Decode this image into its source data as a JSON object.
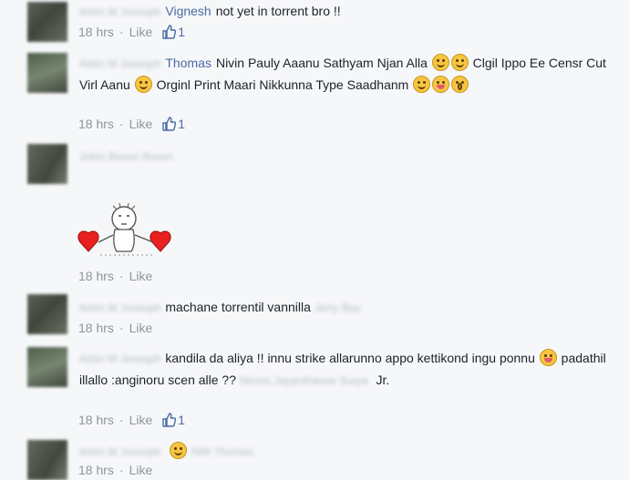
{
  "comments": [
    {
      "author": "Vignesh",
      "text": "not yet in torrent bro !!",
      "time": "18 hrs",
      "like_label": "Like",
      "likes": "1"
    },
    {
      "author": "Thomas",
      "text_1": "Nivin Pauly Aaanu Sathyam Njan Alla",
      "text_2": "Clgil Ippo Ee Censr Cut Virl Aanu",
      "text_3": "Orginl Print Maari Nikkunna Type Saadhanm",
      "time": "18 hrs",
      "like_label": "Like",
      "likes": "1"
    },
    {
      "time": "18 hrs",
      "like_label": "Like"
    },
    {
      "text": "machane torrentil vannilla",
      "time": "18 hrs",
      "like_label": "Like"
    },
    {
      "text_1": "kandila da aliya !! innu strike allarunno appo kettikond ingu ponnu",
      "text_2": "padathil illallo :anginoru scen alle ??",
      "text_3": "Jr.",
      "time": "18 hrs",
      "like_label": "Like",
      "likes": "1"
    },
    {
      "time": "18 hrs",
      "like_label": "Like"
    }
  ],
  "separator": "·",
  "colors": {
    "author": "#4b6aa4",
    "meta": "#90949c",
    "background": "#f6f7f9"
  },
  "icons": {
    "like": "thumbs-up-icon",
    "emoji": "emoji-icon",
    "sticker": "hearts-stickman-sticker"
  }
}
